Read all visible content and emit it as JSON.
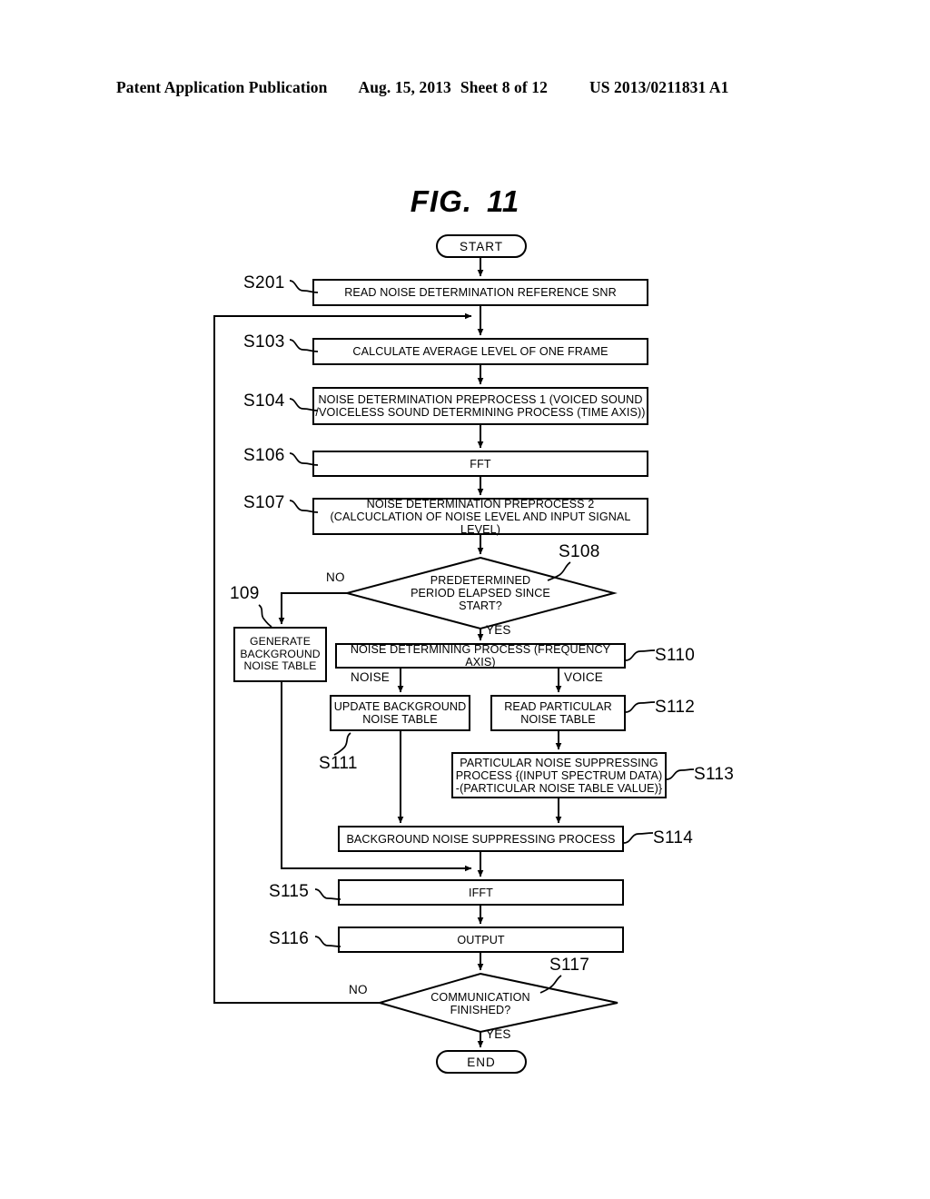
{
  "header": {
    "publication": "Patent Application Publication",
    "date": "Aug. 15, 2013",
    "sheet": "Sheet 8 of 12",
    "number": "US 2013/0211831 A1"
  },
  "figure": {
    "label": "FIG.",
    "number": "11"
  },
  "flowchart": {
    "start_label": "START",
    "end_label": "END",
    "nodes": [
      {
        "id": "S201",
        "tag": "S201",
        "shape": "process",
        "text": "READ NOISE DETERMINATION REFERENCE SNR"
      },
      {
        "id": "S103",
        "tag": "S103",
        "shape": "process",
        "text": "CALCULATE AVERAGE LEVEL OF ONE FRAME"
      },
      {
        "id": "S104",
        "tag": "S104",
        "shape": "process",
        "text": "NOISE DETERMINATION PREPROCESS 1 (VOICED SOUND\n/VOICELESS SOUND DETERMINING PROCESS (TIME AXIS))"
      },
      {
        "id": "S106",
        "tag": "S106",
        "shape": "process",
        "text": "FFT"
      },
      {
        "id": "S107",
        "tag": "S107",
        "shape": "process",
        "text": "NOISE DETERMINATION PREPROCESS 2\n(CALCUCLATION OF NOISE LEVEL AND INPUT SIGNAL LEVEL)"
      },
      {
        "id": "S108",
        "tag": "S108",
        "shape": "decision",
        "text": "PREDETERMINED\nPERIOD ELAPSED SINCE\nSTART?"
      },
      {
        "id": "109",
        "tag": "109",
        "shape": "process",
        "text": "GENERATE\nBACKGROUND\nNOISE TABLE"
      },
      {
        "id": "S110",
        "tag": "S110",
        "shape": "process",
        "text": "NOISE DETERMINING PROCESS (FREQUENCY AXIS)"
      },
      {
        "id": "S111",
        "tag": "S111",
        "shape": "process",
        "text": "UPDATE BACKGROUND\nNOISE TABLE"
      },
      {
        "id": "S112",
        "tag": "S112",
        "shape": "process",
        "text": "READ PARTICULAR\nNOISE TABLE"
      },
      {
        "id": "S113",
        "tag": "S113",
        "shape": "process",
        "text": "PARTICULAR NOISE SUPPRESSING\nPROCESS {(INPUT SPECTRUM DATA)\n-(PARTICULAR NOISE TABLE VALUE)}"
      },
      {
        "id": "S114",
        "tag": "S114",
        "shape": "process",
        "text": "BACKGROUND NOISE SUPPRESSING PROCESS"
      },
      {
        "id": "S115",
        "tag": "S115",
        "shape": "process",
        "text": "IFFT"
      },
      {
        "id": "S116",
        "tag": "S116",
        "shape": "process",
        "text": "OUTPUT"
      },
      {
        "id": "S117",
        "tag": "S117",
        "shape": "decision",
        "text": "COMMUNICATION\nFINISHED?"
      }
    ],
    "edge_labels": {
      "s108_no": "NO",
      "s108_yes": "YES",
      "s110_noise": "NOISE",
      "s110_voice": "VOICE",
      "s117_no": "NO",
      "s117_yes": "YES"
    },
    "colors": {
      "stroke": "#000000",
      "fill": "#ffffff",
      "text": "#000000"
    }
  }
}
